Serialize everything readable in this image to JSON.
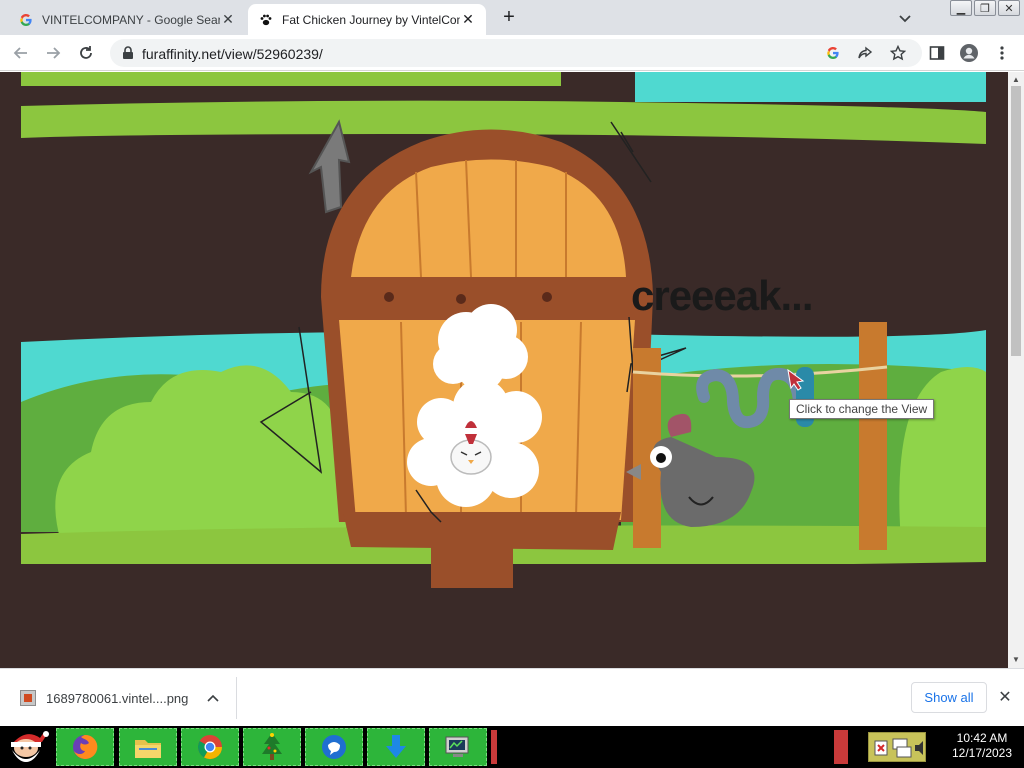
{
  "browser": {
    "tabs": [
      {
        "title": "VINTELCOMPANY - Google Search",
        "favicon": "google-icon",
        "active": false
      },
      {
        "title": "Fat Chicken Journey by VintelCompany",
        "favicon": "paw-icon",
        "active": true
      }
    ],
    "url": "furaffinity.net/view/52960239/"
  },
  "page": {
    "scene_text": "creeeak...",
    "tooltip": "Click to change the View"
  },
  "download_bar": {
    "file_name": "1689780061.vintel....png",
    "show_all_label": "Show all"
  },
  "taskbar": {
    "apps": [
      "start-santa-icon",
      "firefox-icon",
      "file-explorer-icon",
      "chrome-icon",
      "christmas-tree-icon",
      "messenger-icon",
      "download-icon",
      "network-monitor-icon"
    ],
    "time": "10:42 AM",
    "date": "12/17/2023"
  },
  "colors": {
    "sky_teal": "#4fd9d0",
    "grass": "#8cc63f",
    "ground": "#3a2a28",
    "wood_light": "#f0a94a",
    "wood_dark": "#9a4f2a",
    "download_link": "#1a73e8"
  }
}
